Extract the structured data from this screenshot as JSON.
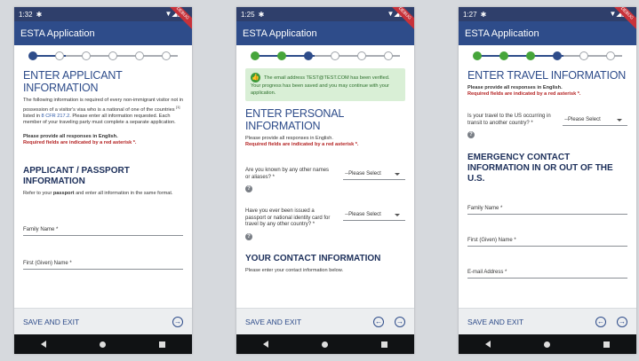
{
  "screens": [
    {
      "time": "1:32",
      "title": "ESTA Application",
      "progress_fraction": 0.25,
      "h1": "ENTER APPLICANT INFORMATION",
      "intro_a": "The following information is required of every non-immigrant visitor not in possession of a visitor's visa who is a national of one of the countries ",
      "intro_sup": "[1]",
      "intro_b": " listed in ",
      "intro_link": "8 CFR 217.2",
      "intro_c": ". Please enter all information requested. Each member of your traveling party must complete a separate application.",
      "english": "Please provide all responses in English.",
      "required": "Required fields are indicated by a red asterisk *.",
      "h2": "APPLICANT / PASSPORT INFORMATION",
      "passport_a": "Refer to your ",
      "passport_b": "passport",
      "passport_c": " and enter all information in the same format.",
      "field1": "Family Name *",
      "field2": "First (Given) Name *",
      "save": "SAVE AND EXIT"
    },
    {
      "time": "1:25",
      "title": "ESTA Application",
      "progress_fraction": 0.4,
      "banner": "The email address TEST@TEST.COM has been verified. Your progress has been saved and you may continue with your application.",
      "h1": "ENTER PERSONAL INFORMATION",
      "english": "Please provide all responses in English.",
      "required": "Required fields are indicated by a red asterisk *.",
      "q1": "Are you known by any other names or aliases? *",
      "q2": "Have you ever been issued a passport or national identity card for travel by any other country? *",
      "select": "--Please Select",
      "h2": "YOUR CONTACT INFORMATION",
      "contact_text": "Please enter your contact information below.",
      "save": "SAVE AND EXIT"
    },
    {
      "time": "1:27",
      "title": "ESTA Application",
      "progress_fraction": 0.55,
      "h1": "ENTER TRAVEL INFORMATION",
      "english": "Please provide all responses in English.",
      "required": "Required fields are indicated by a red asterisk *.",
      "q1": "Is your travel to the US occurring in transit to another country? *",
      "select": "--Please Select",
      "h2": "EMERGENCY CONTACT INFORMATION IN OR OUT OF THE U.S.",
      "field1": "Family Name *",
      "field2": "First (Given) Name *",
      "field3": "E-mail Address *",
      "save": "SAVE AND EXIT"
    }
  ],
  "ribbon_text": "DEBUG",
  "icons": {
    "status": "gear-icon",
    "help": "help-icon",
    "back": "arrow-left-circle-icon",
    "next": "arrow-right-circle-icon"
  }
}
